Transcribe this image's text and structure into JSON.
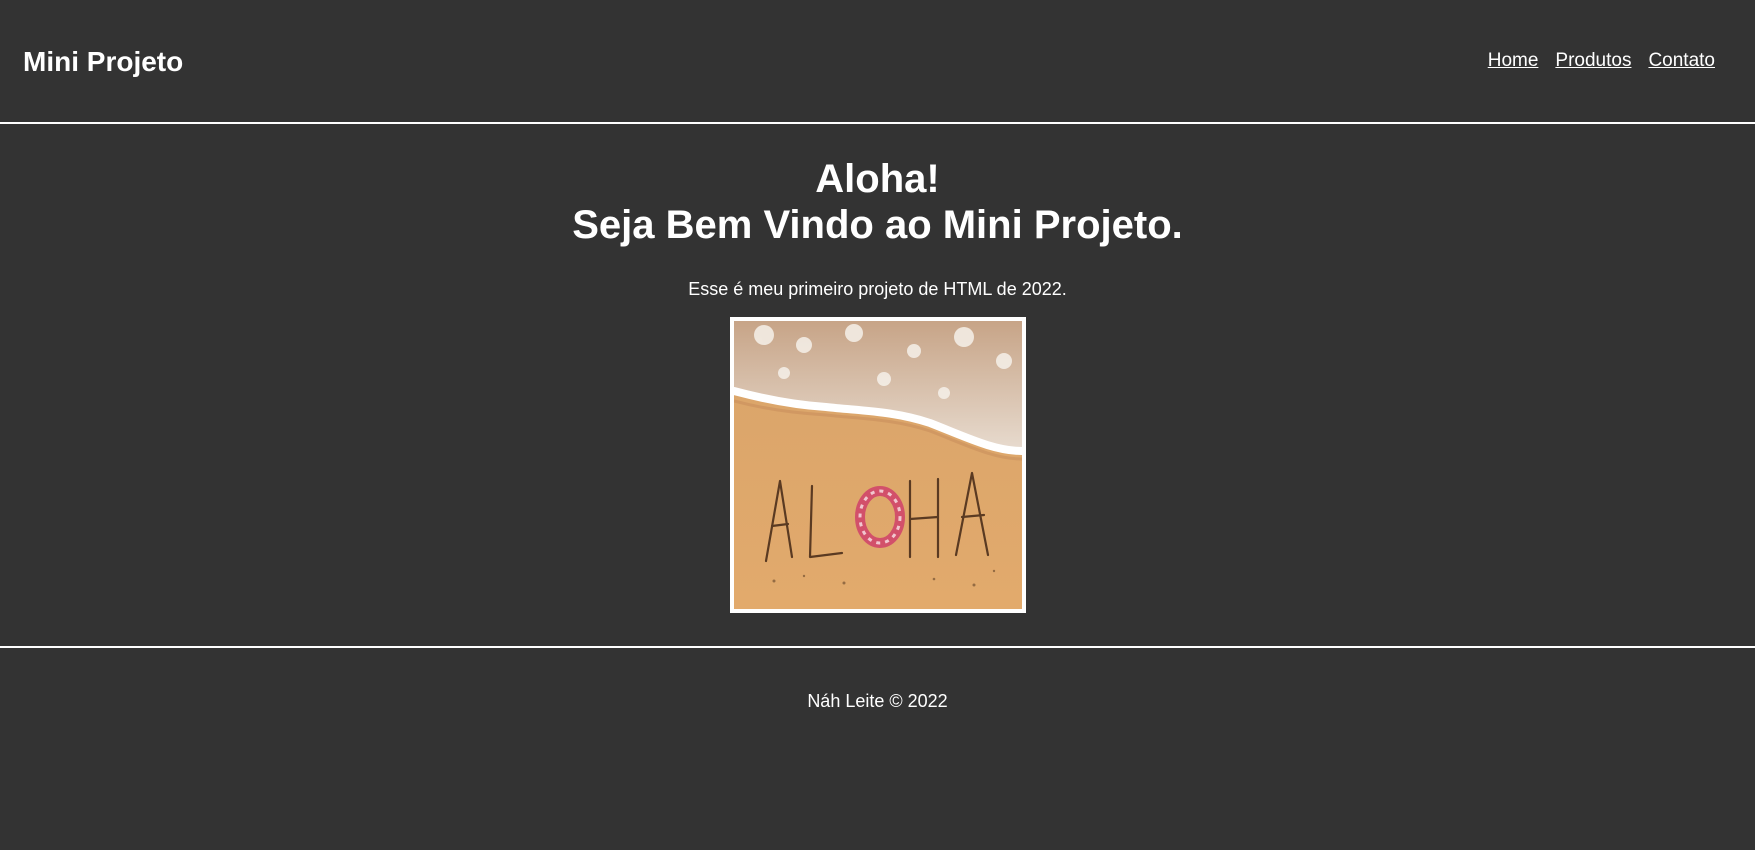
{
  "header": {
    "brand": "Mini Projeto",
    "nav": {
      "home": "Home",
      "produtos": "Produtos",
      "contato": "Contato"
    }
  },
  "main": {
    "title_line1": "Aloha!",
    "title_line2": "Seja Bem Vindo ao Mini Projeto.",
    "intro": "Esse é meu primeiro projeto de HTML de 2022.",
    "image": {
      "sand_word": "ALOHA"
    }
  },
  "footer": {
    "copyright": "Náh Leite © 2022"
  },
  "colors": {
    "background": "#333333",
    "text": "#ffffff",
    "divider": "#ffffff"
  }
}
